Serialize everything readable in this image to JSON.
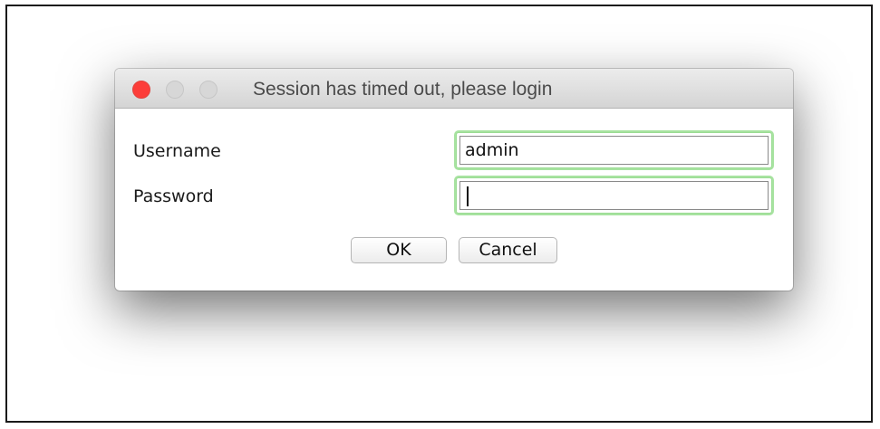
{
  "dialog": {
    "title": "Session has timed out, please login",
    "window_controls": [
      "close-icon",
      "minimize-icon",
      "zoom-icon"
    ],
    "fields": {
      "username": {
        "label": "Username",
        "value": "admin"
      },
      "password": {
        "label": "Password",
        "value": ""
      }
    },
    "buttons": {
      "ok": "OK",
      "cancel": "Cancel"
    },
    "colors": {
      "close": "#fc3d39",
      "focus_ring": "#a8e3a1"
    }
  }
}
